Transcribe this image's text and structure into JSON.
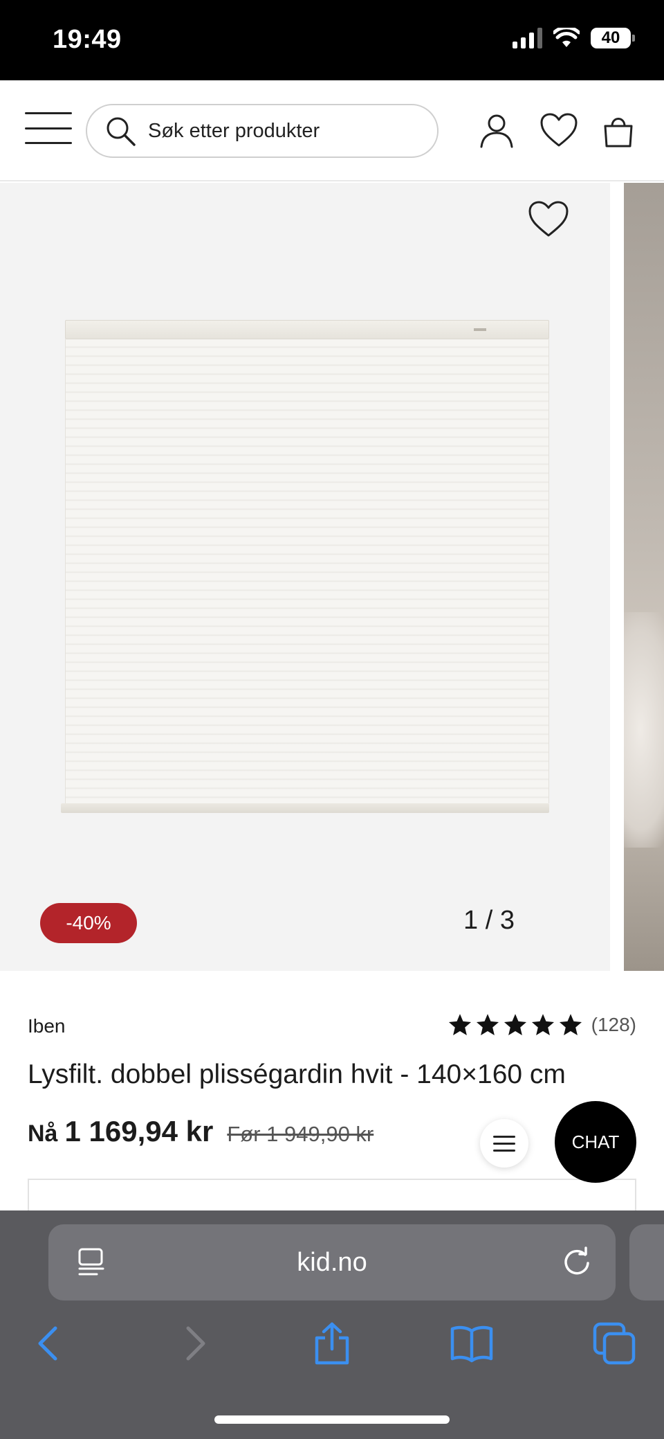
{
  "status_bar": {
    "time": "19:49",
    "battery": "40"
  },
  "header": {
    "search_placeholder": "Søk etter produkter",
    "icons": [
      "menu-icon",
      "search-icon",
      "user-icon",
      "heart-icon",
      "shopping-bag-icon"
    ]
  },
  "gallery": {
    "discount_badge": "-40%",
    "counter": "1 / 3",
    "icons": [
      "heart-icon"
    ]
  },
  "product": {
    "brand": "Iben",
    "rating_stars": 5,
    "rating_count": "(128)",
    "title": "Lysfilt. dobbel plisségardin hvit - 140×160 cm",
    "price_prefix": "Nå",
    "price_now": "1 169,94 kr",
    "price_before": "Før 1 949,90 kr"
  },
  "floating": {
    "chat_label": "CHAT"
  },
  "browser": {
    "url": "kid.no",
    "icons": [
      "reader-icon",
      "reload-icon",
      "back-icon",
      "forward-icon",
      "share-icon",
      "bookmarks-icon",
      "tabs-icon"
    ],
    "accent_color": "#3b8ff0"
  },
  "colors": {
    "discount_red": "#b3242a",
    "chat_black": "#000000"
  }
}
